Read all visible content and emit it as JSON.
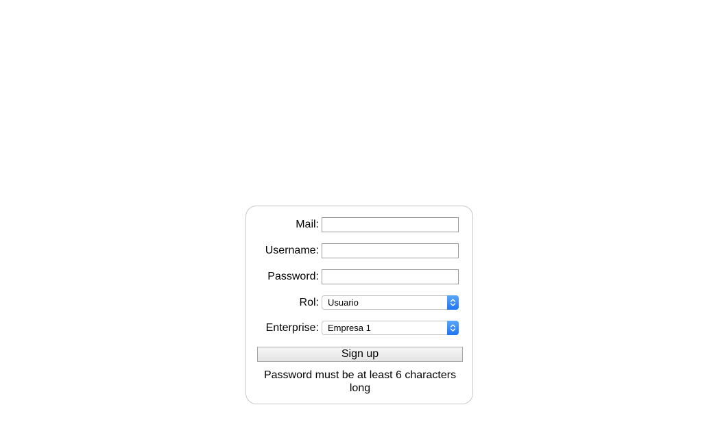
{
  "form": {
    "mail_label": "Mail:",
    "mail_value": "",
    "username_label": "Username:",
    "username_value": "",
    "password_label": "Password:",
    "password_value": "",
    "rol_label": "Rol:",
    "rol_selected": "Usuario",
    "enterprise_label": "Enterprise:",
    "enterprise_selected": "Empresa 1",
    "signup_label": "Sign up",
    "validation_message": "Password must be at least 6 characters long"
  },
  "icons": {
    "select_stepper": "chevron-up-down-icon"
  },
  "colors": {
    "stepper_top": "#5aa8fb",
    "stepper_bottom": "#1e74f0",
    "card_border": "#c8c8c8"
  }
}
